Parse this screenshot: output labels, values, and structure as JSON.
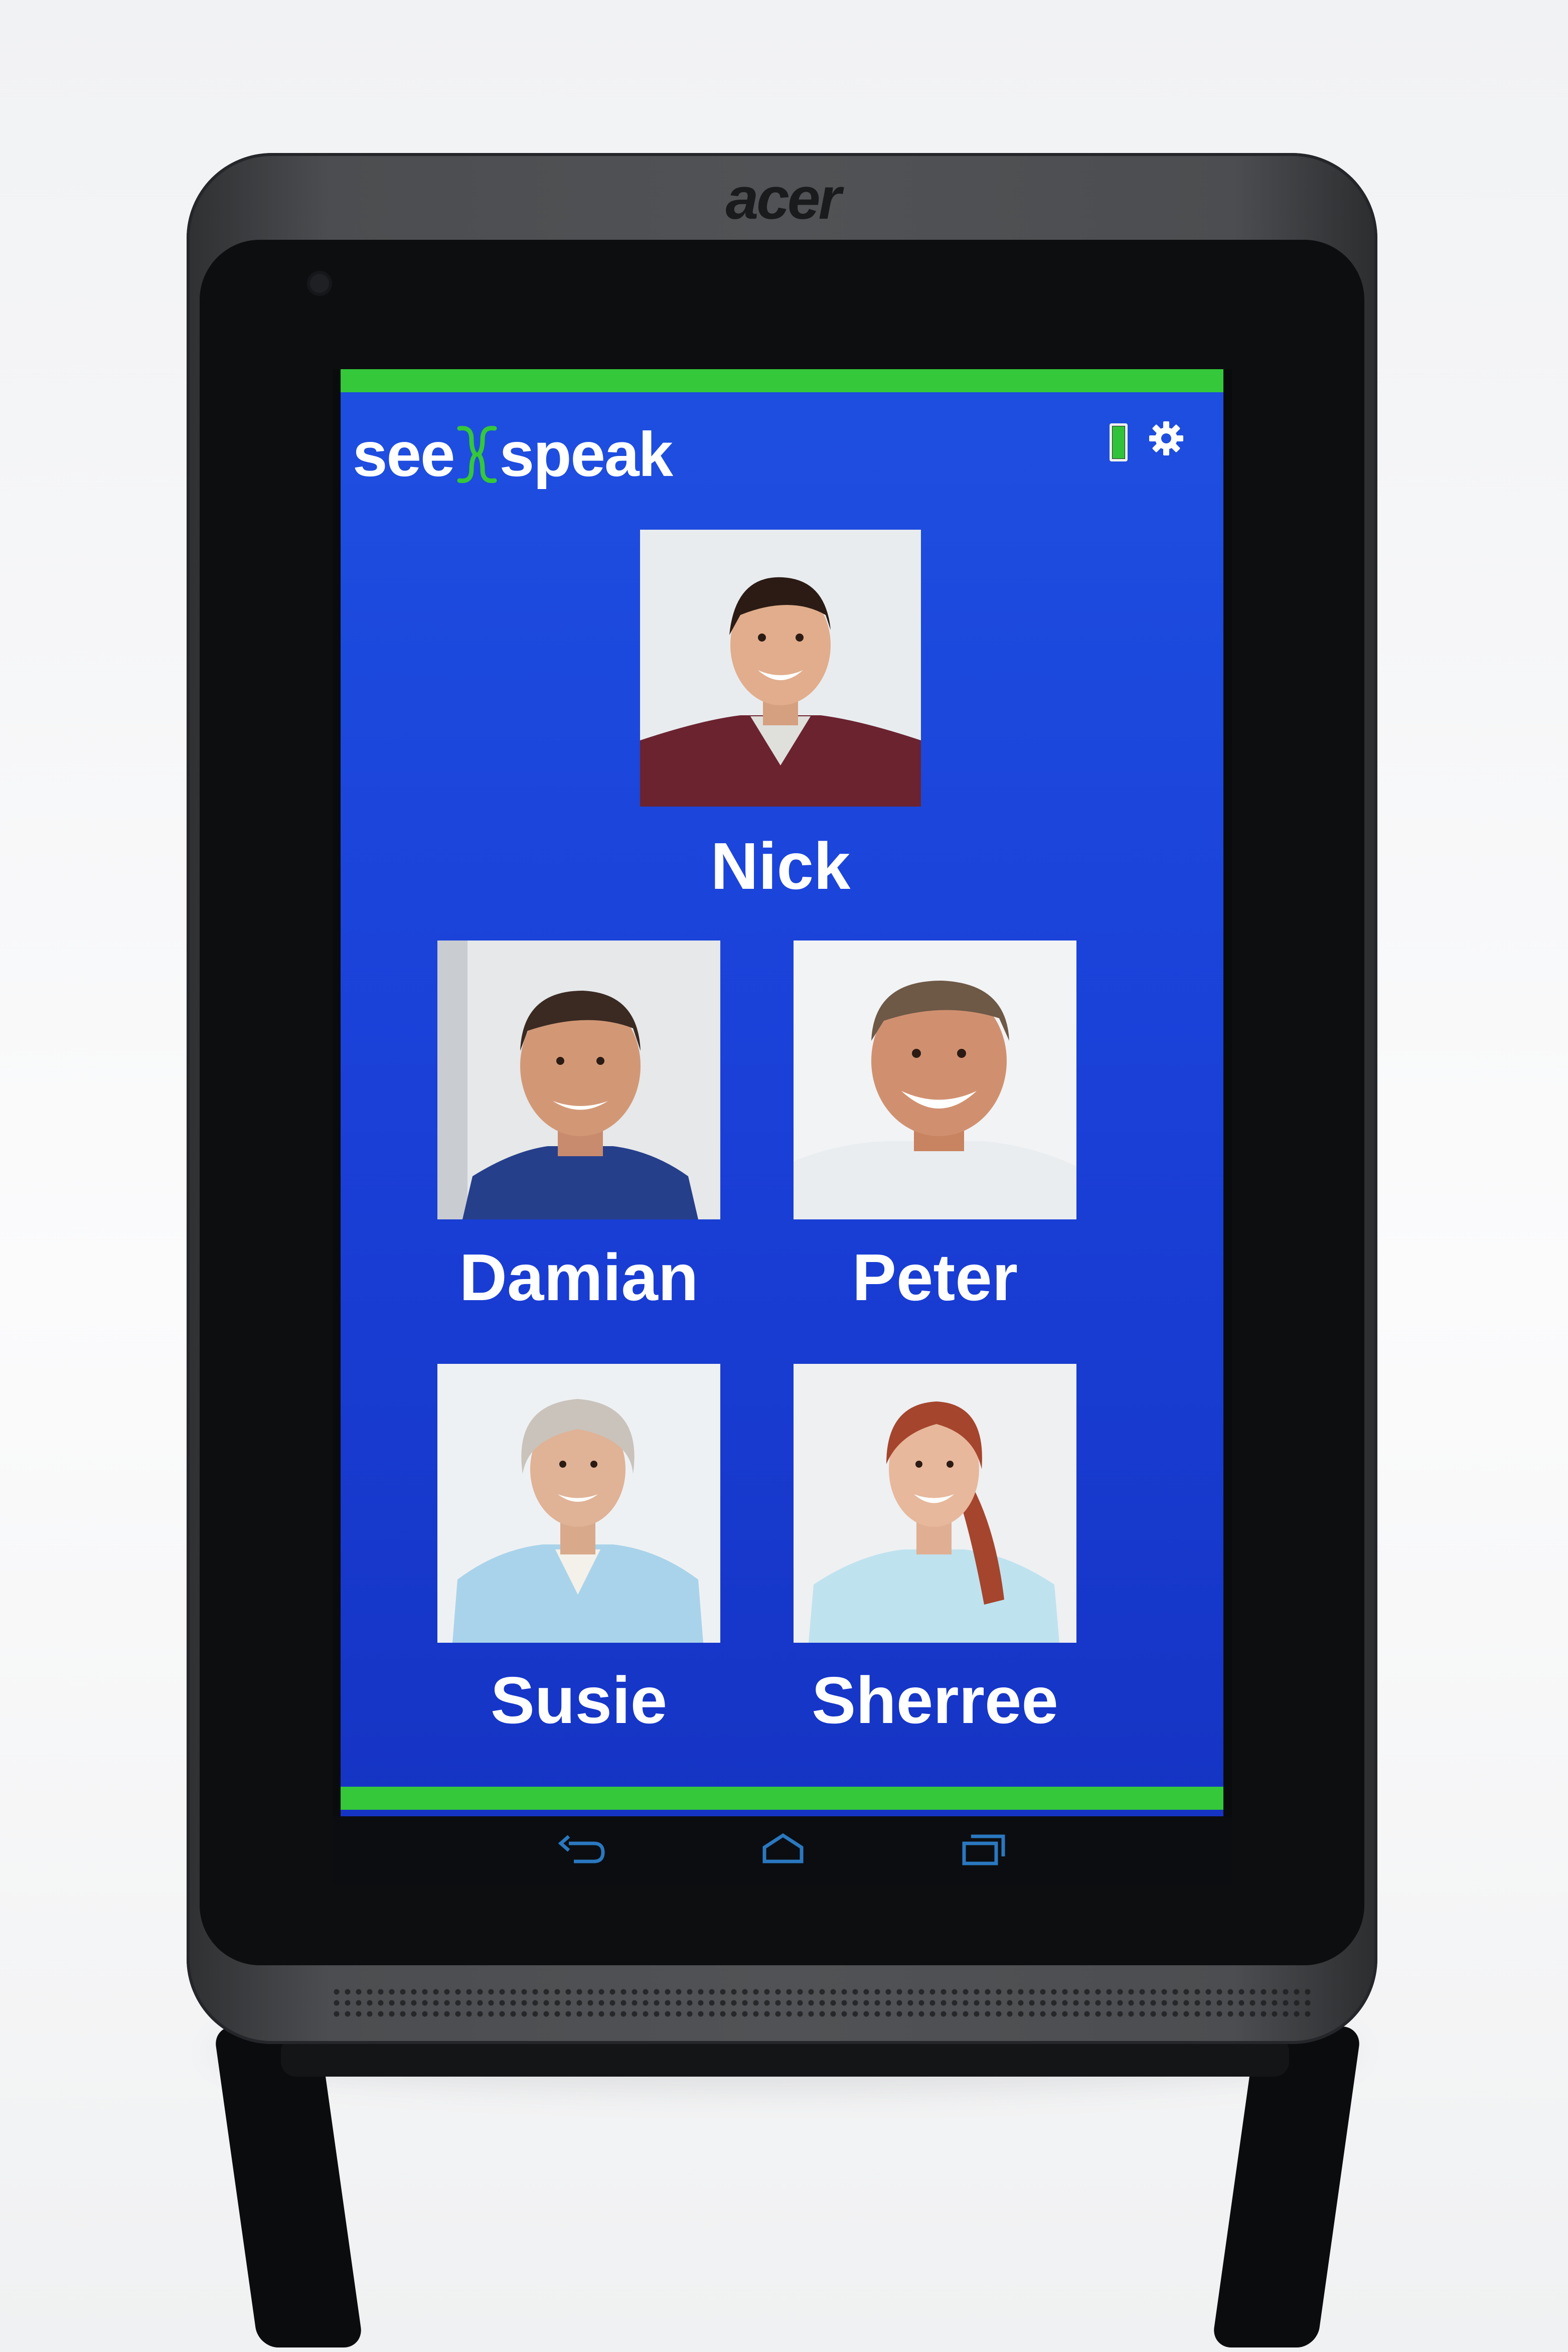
{
  "device": {
    "brand": "acer"
  },
  "app": {
    "logo": {
      "left_word": "see",
      "right_word": "speak"
    },
    "status": {
      "battery_level": 1.0,
      "battery_color": "#2fc23a"
    },
    "colors": {
      "background": "#1e4fe0",
      "accent": "#34c83a",
      "text": "#ffffff"
    }
  },
  "contacts": [
    {
      "name": "Nick"
    },
    {
      "name": "Damian"
    },
    {
      "name": "Peter"
    },
    {
      "name": "Susie"
    },
    {
      "name": "Sherree"
    }
  ],
  "navbar": {
    "buttons": [
      "back-icon",
      "home-icon",
      "recent-apps-icon"
    ]
  }
}
